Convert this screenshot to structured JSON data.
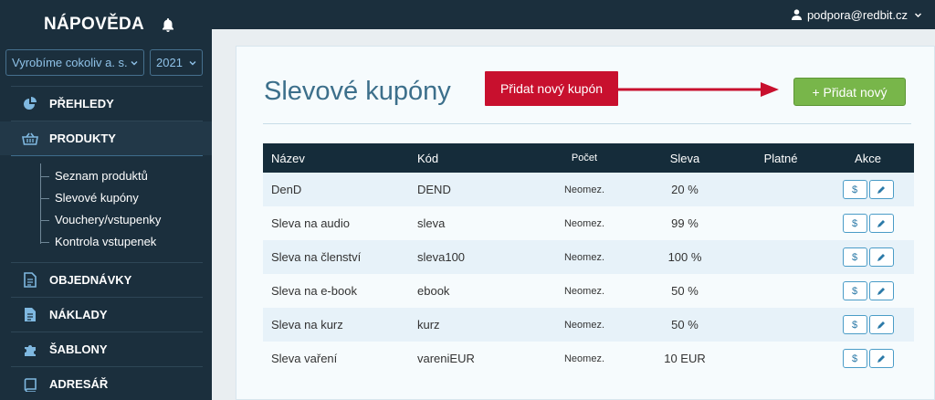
{
  "sidebar": {
    "brand": "NÁPOVĚDA",
    "company_select": "Vyrobíme cokoliv a. s.",
    "year_select": "2021",
    "items": [
      {
        "label": "PŘEHLEDY",
        "icon": "pie-chart-icon"
      },
      {
        "label": "PRODUKTY",
        "icon": "basket-icon"
      },
      {
        "label": "OBJEDNÁVKY",
        "icon": "document-icon"
      },
      {
        "label": "NÁKLADY",
        "icon": "document-icon"
      },
      {
        "label": "ŠABLONY",
        "icon": "puzzle-icon"
      },
      {
        "label": "ADRESÁŘ",
        "icon": "book-icon"
      }
    ],
    "subitems": [
      "Seznam produktů",
      "Slevové kupóny",
      "Vouchery/vstupenky",
      "Kontrola vstupenek"
    ]
  },
  "topbar": {
    "user": "podpora@redbit.cz"
  },
  "main": {
    "title": "Slevové kupóny",
    "callout": "Přidat nový kupón",
    "add_button": "+ Přidat nový",
    "columns": [
      "Název",
      "Kód",
      "Počet",
      "Sleva",
      "Platné",
      "Akce"
    ],
    "rows": [
      {
        "name": "DenD",
        "code": "DEND",
        "count": "Neomez.",
        "discount": "20 %",
        "valid": ""
      },
      {
        "name": "Sleva na audio",
        "code": "sleva",
        "count": "Neomez.",
        "discount": "99 %",
        "valid": ""
      },
      {
        "name": "Sleva na členství",
        "code": "sleva100",
        "count": "Neomez.",
        "discount": "100 %",
        "valid": ""
      },
      {
        "name": "Sleva na e-book",
        "code": "ebook",
        "count": "Neomez.",
        "discount": "50 %",
        "valid": ""
      },
      {
        "name": "Sleva na kurz",
        "code": "kurz",
        "count": "Neomez.",
        "discount": "50 %",
        "valid": ""
      },
      {
        "name": "Sleva vaření",
        "code": "vareniEUR",
        "count": "Neomez.",
        "discount": "10 EUR",
        "valid": ""
      }
    ],
    "action_money": "$"
  },
  "colors": {
    "sidebar": "#1b2f3d",
    "callout": "#c8102e",
    "add_button": "#78b64a",
    "title": "#3c6f8b",
    "table_header": "#152c3a"
  }
}
